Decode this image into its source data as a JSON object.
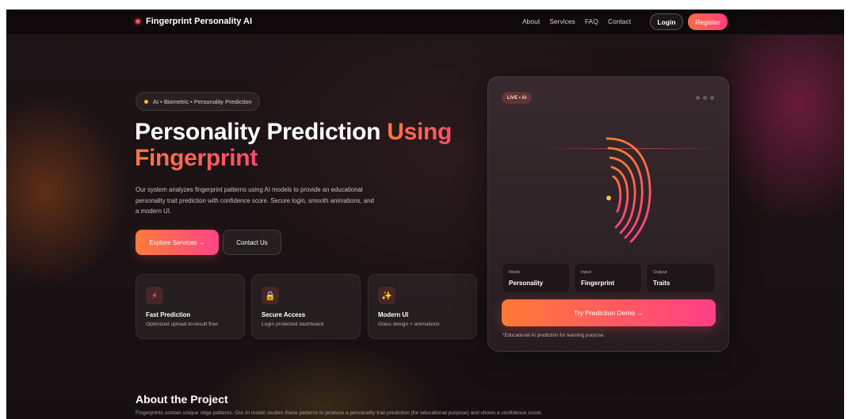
{
  "nav": {
    "brand": "Fingerprint Personality AI",
    "links": [
      "About",
      "Services",
      "FAQ",
      "Contact"
    ],
    "login": "Login",
    "register": "Register"
  },
  "hero": {
    "pill": "AI • Biometric • Personality Prediction",
    "title_main": "Personality Prediction ",
    "title_accent_1": "Using",
    "title_accent_2": "Fingerprint",
    "description": "Our system analyzes fingerprint patterns using AI models to provide an educational personality trait prediction with confidence score. Secure login, smooth animations, and a modern UI.",
    "explore_button": "Explore Services →",
    "contact_button": "Contact Us"
  },
  "features": [
    {
      "icon": "lightning-icon",
      "glyph": "⚡",
      "title": "Fast Prediction",
      "subtitle": "Optimized upload-to-result flow"
    },
    {
      "icon": "lock-icon",
      "glyph": "🔒",
      "title": "Secure Access",
      "subtitle": "Login protected dashboard"
    },
    {
      "icon": "sparkle-icon",
      "glyph": "✨",
      "title": "Modern UI",
      "subtitle": "Glass design + animations"
    }
  ],
  "demo": {
    "badge": "LIVE • AI",
    "stats": [
      {
        "label": "Mode",
        "value": "Personality"
      },
      {
        "label": "Input",
        "value": "Fingerprint"
      },
      {
        "label": "Output",
        "value": "Traits"
      }
    ],
    "try_button": "Try Prediction Demo →",
    "note": "*Educational AI prediction for learning purpose."
  },
  "about": {
    "title": "About the Project",
    "description": "Fingerprints contain unique ridge patterns. Our AI model studies these patterns to produce a personality trait prediction (for educational purpose) and shows a confidence score."
  },
  "colors": {
    "accent_start": "#ff7a36",
    "accent_end": "#ff3f86",
    "background": "#1a1214"
  }
}
